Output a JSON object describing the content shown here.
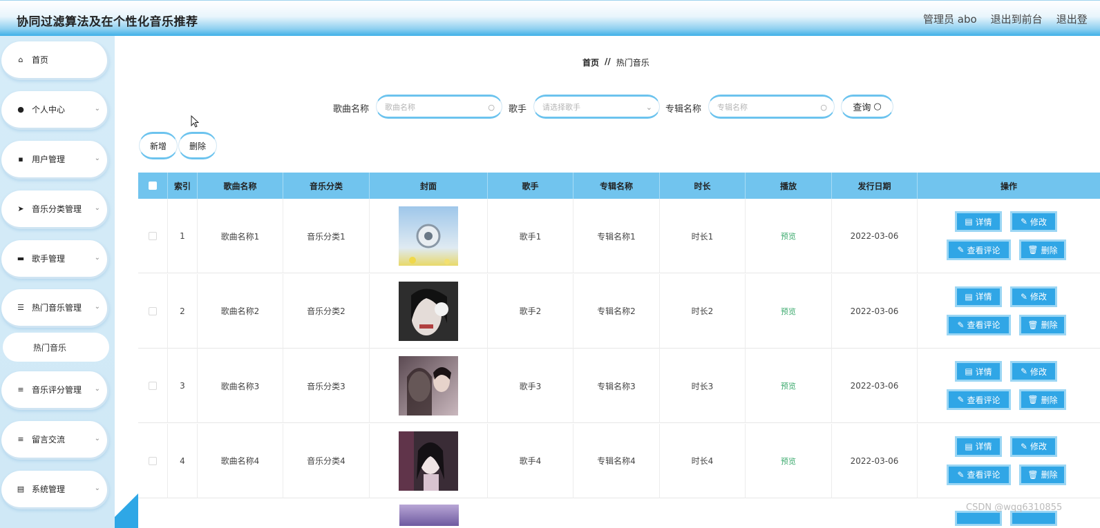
{
  "header": {
    "title": "协同过滤算法及在个性化音乐推荐",
    "admin_label": "管理员 abo",
    "back_front": "退出到前台",
    "logout": "退出登"
  },
  "sidebar": {
    "items": [
      {
        "label": "首页",
        "icon": "home-icon",
        "glyph": "⌂"
      },
      {
        "label": "个人中心",
        "icon": "user-icon",
        "glyph": "●"
      },
      {
        "label": "用户管理",
        "icon": "users-icon",
        "glyph": "▪"
      },
      {
        "label": "音乐分类管理",
        "icon": "send-icon",
        "glyph": "➤"
      },
      {
        "label": "歌手管理",
        "icon": "chat-icon",
        "glyph": "▬"
      },
      {
        "label": "热门音乐管理",
        "icon": "list-icon",
        "glyph": "☰"
      },
      {
        "label": "音乐评分管理",
        "icon": "menu-icon",
        "glyph": "≡"
      },
      {
        "label": "留言交流",
        "icon": "menu-icon",
        "glyph": "≡"
      },
      {
        "label": "系统管理",
        "icon": "clipboard-icon",
        "glyph": "▤"
      }
    ],
    "sub_item": "热门音乐"
  },
  "breadcrumb": {
    "home": "首页",
    "separator": "//",
    "current": "热门音乐"
  },
  "search": {
    "song_label": "歌曲名称",
    "song_placeholder": "歌曲名称",
    "singer_label": "歌手",
    "singer_placeholder": "请选择歌手",
    "album_label": "专辑名称",
    "album_placeholder": "专辑名称",
    "query_label": "查询"
  },
  "actions": {
    "add": "新增",
    "delete": "删除"
  },
  "table": {
    "headers": [
      "索引",
      "歌曲名称",
      "音乐分类",
      "封面",
      "歌手",
      "专辑名称",
      "时长",
      "播放",
      "发行日期",
      "操作"
    ],
    "rows": [
      {
        "index": "1",
        "song": "歌曲名称1",
        "category": "音乐分类1",
        "singer": "歌手1",
        "album": "专辑名称1",
        "duration": "时长1",
        "play": "预览",
        "date": "2022-03-06"
      },
      {
        "index": "2",
        "song": "歌曲名称2",
        "category": "音乐分类2",
        "singer": "歌手2",
        "album": "专辑名称2",
        "duration": "时长2",
        "play": "预览",
        "date": "2022-03-06"
      },
      {
        "index": "3",
        "song": "歌曲名称3",
        "category": "音乐分类3",
        "singer": "歌手3",
        "album": "专辑名称3",
        "duration": "时长3",
        "play": "预览",
        "date": "2022-03-06"
      },
      {
        "index": "4",
        "song": "歌曲名称4",
        "category": "音乐分类4",
        "singer": "歌手4",
        "album": "专辑名称4",
        "duration": "时长4",
        "play": "预览",
        "date": "2022-03-06"
      }
    ],
    "ops": {
      "detail": "详情",
      "edit": "修改",
      "comments": "查看评论",
      "delete": "删除"
    }
  },
  "colors": {
    "accent": "#30a6e6",
    "header_blue": "#71c4ee",
    "preview_green": "#3caa6e"
  },
  "watermark": "CSDN @wqq6310855"
}
